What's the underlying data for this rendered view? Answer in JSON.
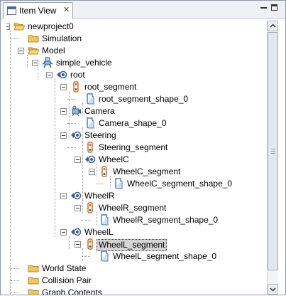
{
  "window": {
    "title": "Item View",
    "close_glyph": "✕"
  },
  "tree": {
    "items": [
      {
        "label": "newproject0",
        "icon": "folder-open-icon",
        "expanded": true
      },
      {
        "label": "Simulation",
        "icon": "folder-icon"
      },
      {
        "label": "Model",
        "icon": "folder-open-icon",
        "expanded": true
      },
      {
        "label": "simple_vehicle",
        "icon": "robot-model-icon",
        "expanded": true
      },
      {
        "label": "root",
        "icon": "joint-icon",
        "expanded": true
      },
      {
        "label": "root_segment",
        "icon": "segment-icon",
        "expanded": true
      },
      {
        "label": "root_segment_shape_0",
        "icon": "shape-icon"
      },
      {
        "label": "Camera",
        "icon": "camera-icon",
        "expanded": true
      },
      {
        "label": "Camera_shape_0",
        "icon": "shape-icon"
      },
      {
        "label": "Steering",
        "icon": "joint-icon",
        "expanded": true
      },
      {
        "label": "Steering_segment",
        "icon": "segment-icon"
      },
      {
        "label": "WheelC",
        "icon": "joint-icon",
        "expanded": true
      },
      {
        "label": "WheelC_segment",
        "icon": "segment-icon",
        "expanded": true
      },
      {
        "label": "WheelC_segment_shape_0",
        "icon": "shape-icon"
      },
      {
        "label": "WheelR",
        "icon": "joint-icon",
        "expanded": true
      },
      {
        "label": "WheelR_segment",
        "icon": "segment-icon",
        "expanded": true
      },
      {
        "label": "WheelR_segment_shape_0",
        "icon": "shape-icon"
      },
      {
        "label": "WheelL",
        "icon": "joint-icon",
        "expanded": true
      },
      {
        "label": "WheelL_segment",
        "icon": "segment-icon",
        "expanded": true,
        "selected": true
      },
      {
        "label": "WheelL_segment_shape_0",
        "icon": "shape-icon"
      },
      {
        "label": "World State",
        "icon": "folder-icon"
      },
      {
        "label": "Collision Pair",
        "icon": "folder-icon"
      },
      {
        "label": "Graph Contents",
        "icon": "folder-icon"
      }
    ]
  },
  "colors": {
    "folder": "#f2c65a",
    "joint": "#3a5f8f",
    "segment": "#d06a1e",
    "shape": "#4a7fc1",
    "selection": "#d4d4d4"
  }
}
